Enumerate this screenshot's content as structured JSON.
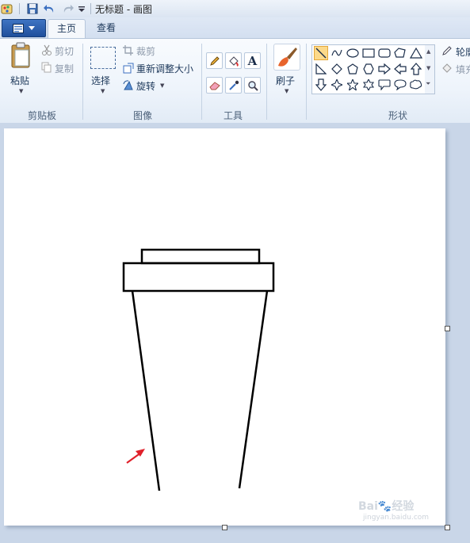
{
  "titlebar": {
    "title": "无标题 - 画图"
  },
  "tabs": {
    "home": "主页",
    "view": "查看"
  },
  "ribbon": {
    "clipboard": {
      "paste": "粘贴",
      "cut": "剪切",
      "copy": "复制",
      "group": "剪贴板"
    },
    "image": {
      "select": "选择",
      "crop": "裁剪",
      "resize": "重新调整大小",
      "rotate": "旋转",
      "group": "图像"
    },
    "tools": {
      "group": "工具",
      "text_glyph": "A"
    },
    "brushes": {
      "label": "刷子"
    },
    "shapes": {
      "group": "形状",
      "outline": "轮廓",
      "fill": "填充"
    }
  },
  "watermark": {
    "brand": "Bai🐾经验",
    "url": "jingyan.baidu.com"
  },
  "colors": {
    "accent": "#1f4f9c",
    "stroke": "#000000",
    "arrow": "#e0202a",
    "selected_shape": "#fcd98a"
  }
}
